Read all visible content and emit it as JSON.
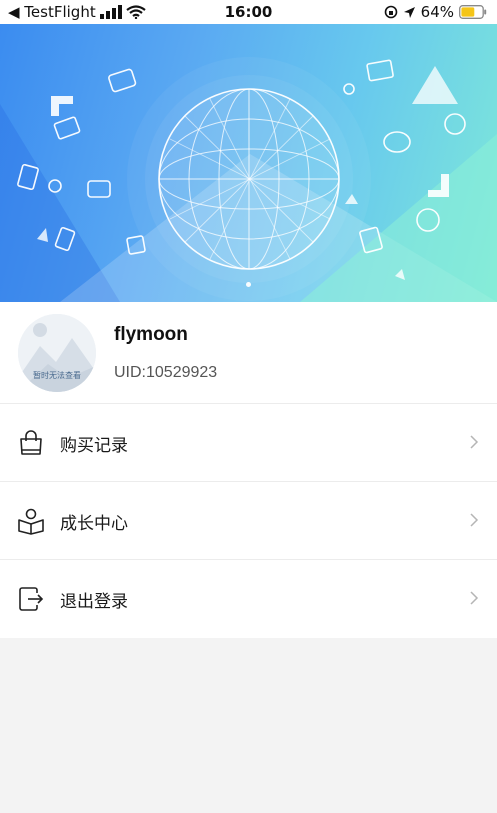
{
  "status_bar": {
    "back_app": "◀ TestFlight",
    "time": "16:00",
    "battery": "64%",
    "battery_level": 0.64,
    "icons": [
      "signal-icon",
      "wifi-icon",
      "orientation-lock-icon",
      "location-icon",
      "battery-icon"
    ]
  },
  "banner": {
    "slide_count": 1,
    "active_slide": 1
  },
  "profile": {
    "username": "flymoon",
    "uid": "UID:10529923",
    "avatar_caption": "暂时无法查看"
  },
  "menu": {
    "items": [
      {
        "label": "购买记录",
        "icon": "shopping-bag-icon"
      },
      {
        "label": "成长中心",
        "icon": "reading-person-icon"
      },
      {
        "label": "退出登录",
        "icon": "logout-icon"
      }
    ]
  },
  "colors": {
    "banner_start": "#3b8cf0",
    "banner_end": "#7ee8d9",
    "battery_fill": "#f5c518",
    "page_background": "#f3f3f3"
  }
}
